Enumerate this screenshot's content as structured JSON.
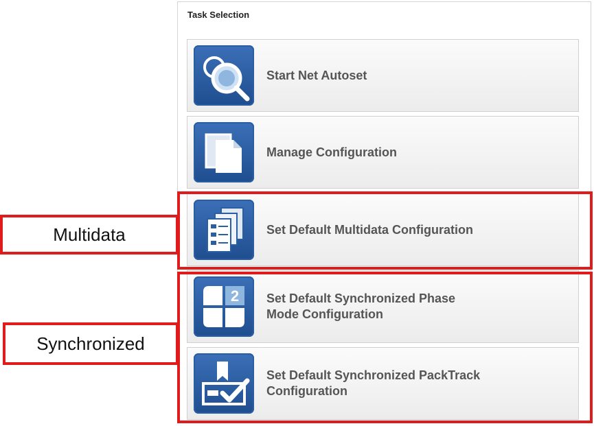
{
  "panel": {
    "title": "Task Selection"
  },
  "tasks": [
    {
      "line1": "Start Net Autoset",
      "line2": "",
      "icon": "magnifier-icon"
    },
    {
      "line1": "Manage Configuration",
      "line2": "",
      "icon": "documents-icon"
    },
    {
      "line1": "Set Default Multidata Configuration",
      "line2": "",
      "icon": "multidata-icon"
    },
    {
      "line1": "Set Default Synchronized Phase",
      "line2": "Mode Configuration",
      "icon": "phase-2-icon"
    },
    {
      "line1": "Set Default Synchronized PackTrack",
      "line2": "Configuration",
      "icon": "packtrack-icon"
    }
  ],
  "callouts": {
    "multidata": "Multidata",
    "synchronized": "Synchronized"
  },
  "colors": {
    "highlight": "#e01b1b",
    "icon_blue": "#2a5ea3",
    "label_gray": "#555555"
  }
}
